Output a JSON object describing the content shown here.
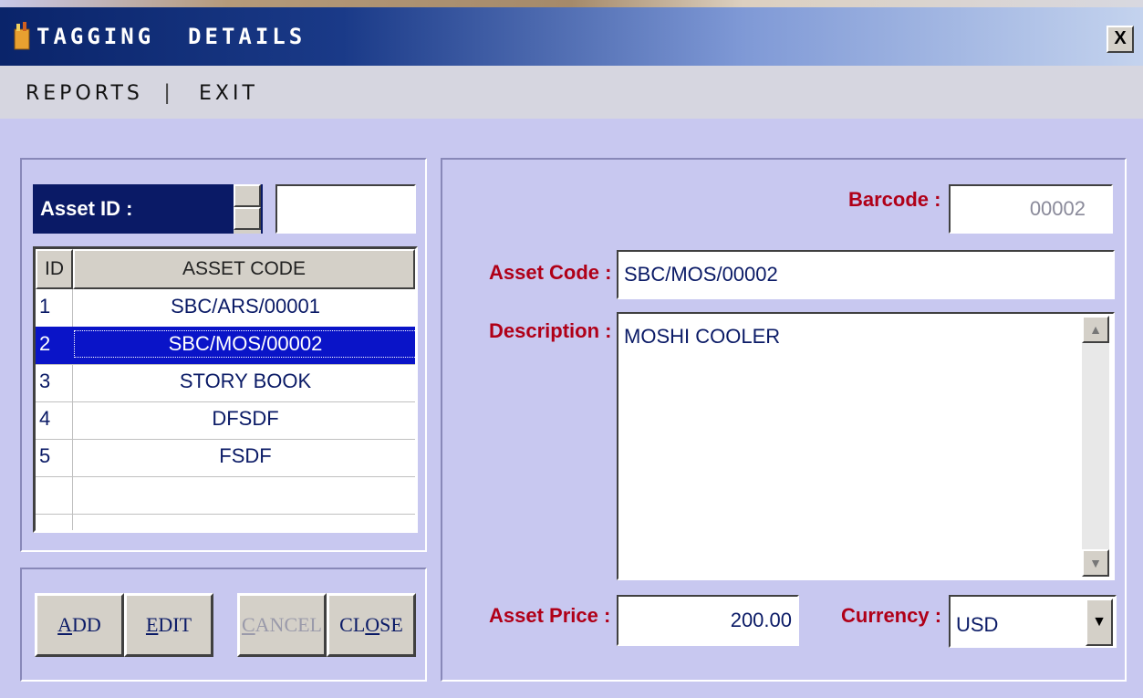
{
  "window": {
    "title": "TAGGING  DETAILS",
    "close_glyph": "X"
  },
  "menu": {
    "reports": "REPORTS",
    "separator": "|",
    "exit": "EXIT"
  },
  "asset_id": {
    "label": "Asset ID :",
    "value": ""
  },
  "grid": {
    "headers": {
      "id": "ID",
      "code": "ASSET CODE"
    },
    "rows": [
      {
        "id": "1",
        "code": "SBC/ARS/00001"
      },
      {
        "id": "2",
        "code": "SBC/MOS/00002"
      },
      {
        "id": "3",
        "code": "STORY BOOK"
      },
      {
        "id": "4",
        "code": "DFSDF"
      },
      {
        "id": "5",
        "code": "FSDF"
      }
    ],
    "selected_index": 1
  },
  "buttons": {
    "add": {
      "first": "A",
      "rest": "DD"
    },
    "edit": {
      "first": "E",
      "rest": "DIT"
    },
    "cancel": {
      "first": "C",
      "rest": "ANCEL"
    },
    "close": {
      "first": "CL",
      "underline": "O",
      "rest": "SE"
    }
  },
  "form": {
    "barcode_label": "Barcode :",
    "barcode_value": "00002",
    "asset_code_label": "Asset Code :",
    "asset_code_value": "SBC/MOS/00002",
    "description_label": "Description :",
    "description_value": "MOSHI COOLER",
    "asset_price_label": "Asset Price :",
    "asset_price_value": "200.00",
    "currency_label": "Currency :",
    "currency_value": "USD"
  },
  "colors": {
    "title_bar": "#0a246a",
    "label_red": "#b00018",
    "selection": "#0a14c8",
    "background": "#c8c8f0"
  },
  "icons": {
    "app": "app-icon",
    "close": "close-icon",
    "spin": "spin-arrows-icon",
    "scroll_up": "scroll-up-arrow-icon",
    "scroll_down": "scroll-down-arrow-icon",
    "dropdown": "dropdown-arrow-icon"
  }
}
